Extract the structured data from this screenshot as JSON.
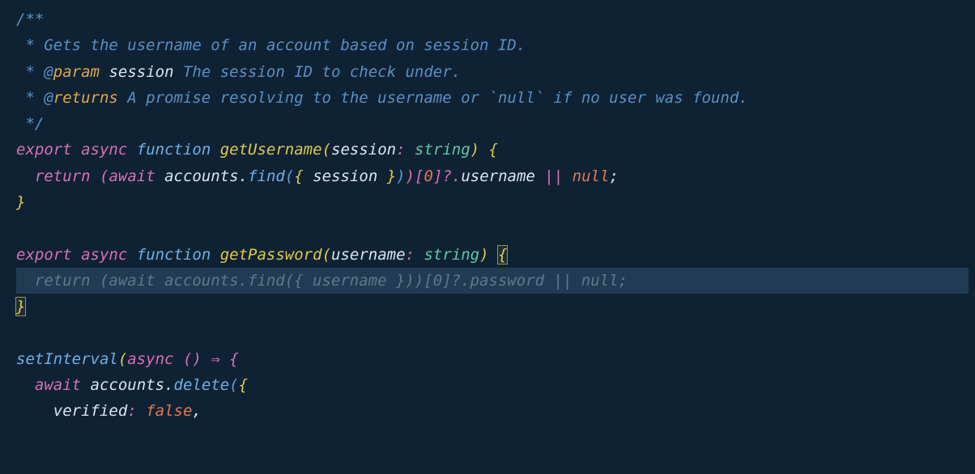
{
  "code": {
    "line1": "/**",
    "line2_star": " * ",
    "line2_text": "Gets the username of an account based on session ID.",
    "line3_star": " * ",
    "line3_at": "@",
    "line3_param": "param",
    "line3_space": " ",
    "line3_name": "session",
    "line3_desc": " The session ID to check under.",
    "line4_star": " * ",
    "line4_at": "@",
    "line4_returns": "returns",
    "line4_desc": " A promise resolving to the username or ",
    "line4_backtick1": "`",
    "line4_null": "null",
    "line4_backtick2": "`",
    "line4_desc2": " if no user was found.",
    "line5": " */",
    "line6_export": "export",
    "line6_async": "async",
    "line6_function": "function",
    "line6_name": "getUsername",
    "line6_lparen": "(",
    "line6_param": "session",
    "line6_colon": ":",
    "line6_type": "string",
    "line6_rparen": ")",
    "line6_lbrace": "{",
    "line7_return": "return",
    "line7_lparen1": "(",
    "line7_await": "await",
    "line7_obj": "accounts",
    "line7_dot1": ".",
    "line7_find": "find",
    "line7_lparen2": "(",
    "line7_lbrace": "{",
    "line7_prop": "session",
    "line7_rbrace": "}",
    "line7_rparen2": ")",
    "line7_rparen1": ")",
    "line7_lbracket": "[",
    "line7_zero": "0",
    "line7_rbracket": "]",
    "line7_optional": "?.",
    "line7_username": "username",
    "line7_or": "||",
    "line7_null": "null",
    "line7_semi": ";",
    "line8_rbrace": "}",
    "line10_export": "export",
    "line10_async": "async",
    "line10_function": "function",
    "line10_name": "getPassword",
    "line10_lparen": "(",
    "line10_param": "username",
    "line10_colon": ":",
    "line10_type": "string",
    "line10_rparen": ")",
    "line10_lbrace": "{",
    "line11_ghost": "  return (await accounts.find({ username }))[0]?.password || null;",
    "line12_rbrace": "}",
    "line14_fn": "setInterval",
    "line14_lparen": "(",
    "line14_async": "async",
    "line14_lparen2": "(",
    "line14_rparen2": ")",
    "line14_arrow": "⇒",
    "line14_lbrace": "{",
    "line15_await": "await",
    "line15_obj": "accounts",
    "line15_dot": ".",
    "line15_delete": "delete",
    "line15_lparen": "(",
    "line15_lbrace": "{",
    "line16_prop": "verified",
    "line16_colon": ":",
    "line16_false": "false",
    "line16_comma": ","
  }
}
